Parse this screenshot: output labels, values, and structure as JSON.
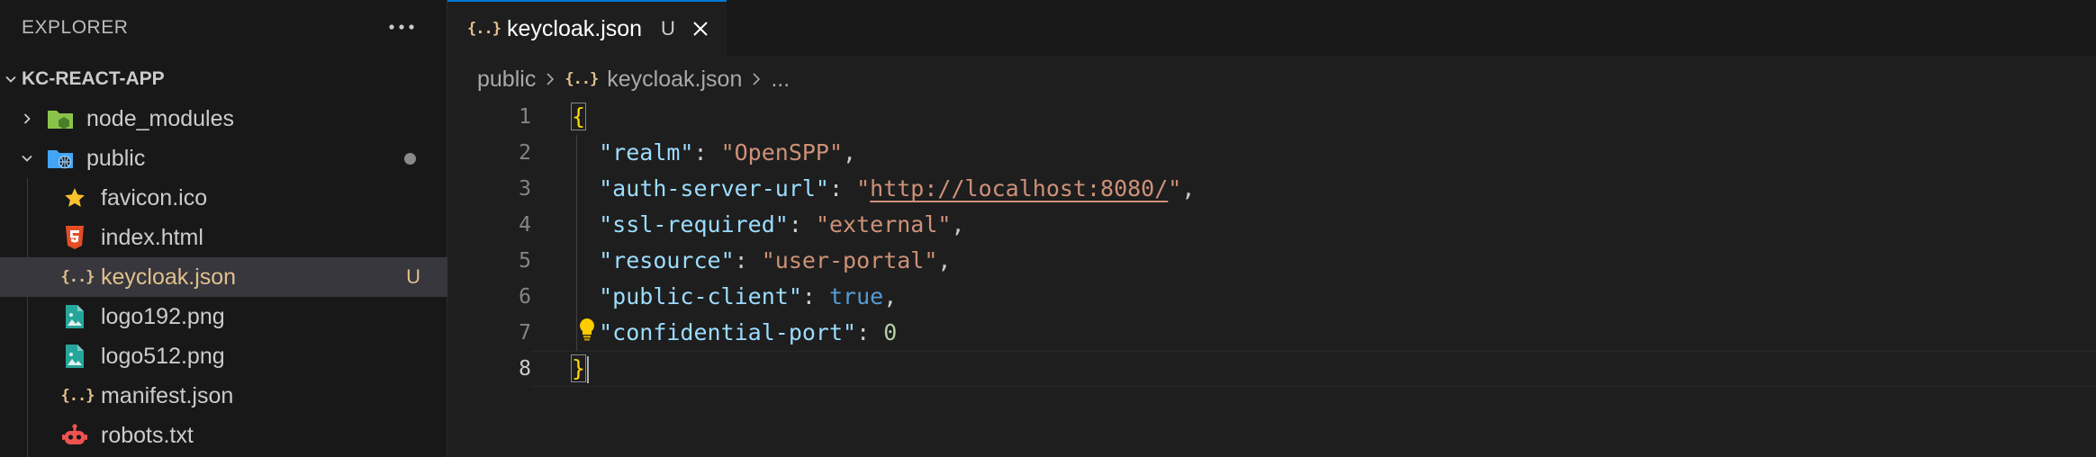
{
  "sidebar": {
    "title": "EXPLORER",
    "more_icon": "ellipsis-icon",
    "project_name": "KC-REACT-APP",
    "items": [
      {
        "label": "node_modules",
        "icon": "folder-node-icon",
        "expanded": false
      },
      {
        "label": "public",
        "icon": "folder-public-icon",
        "expanded": true,
        "status": "modified-dot"
      },
      {
        "label": "favicon.ico",
        "icon": "star-icon"
      },
      {
        "label": "index.html",
        "icon": "html5-icon"
      },
      {
        "label": "keycloak.json",
        "icon": "json-icon",
        "status": "U",
        "selected": true
      },
      {
        "label": "logo192.png",
        "icon": "image-icon"
      },
      {
        "label": "logo512.png",
        "icon": "image-icon"
      },
      {
        "label": "manifest.json",
        "icon": "json-icon"
      },
      {
        "label": "robots.txt",
        "icon": "robot-icon"
      }
    ]
  },
  "editor": {
    "tab": {
      "label": "keycloak.json",
      "status": "U",
      "icon": "json-icon"
    },
    "breadcrumb": {
      "folder": "public",
      "file": "keycloak.json",
      "ellipsis": "..."
    },
    "line_numbers": [
      "1",
      "2",
      "3",
      "4",
      "5",
      "6",
      "7",
      "8"
    ],
    "active_line": "8",
    "code": {
      "open_brace": "{",
      "close_brace": "}",
      "realm_key": "\"realm\"",
      "realm_val": "\"OpenSPP\"",
      "auth_key": "\"auth-server-url\"",
      "auth_q1": "\"",
      "auth_url": "http://localhost:8080/",
      "auth_q2": "\"",
      "ssl_key": "\"ssl-required\"",
      "ssl_val": "\"external\"",
      "resource_key": "\"resource\"",
      "resource_val": "\"user-portal\"",
      "public_key": "\"public-client\"",
      "public_val": "true",
      "conf_key": "\"confidential-port\"",
      "conf_val": "0",
      "colon": ": ",
      "comma": ","
    }
  },
  "colors": {
    "accent": "#0078d4",
    "json_icon": "#e2c08d",
    "string": "#ce9178",
    "key": "#9cdcfe",
    "boolean": "#569cd6",
    "number": "#b5cea8",
    "brace": "#ffd700"
  }
}
